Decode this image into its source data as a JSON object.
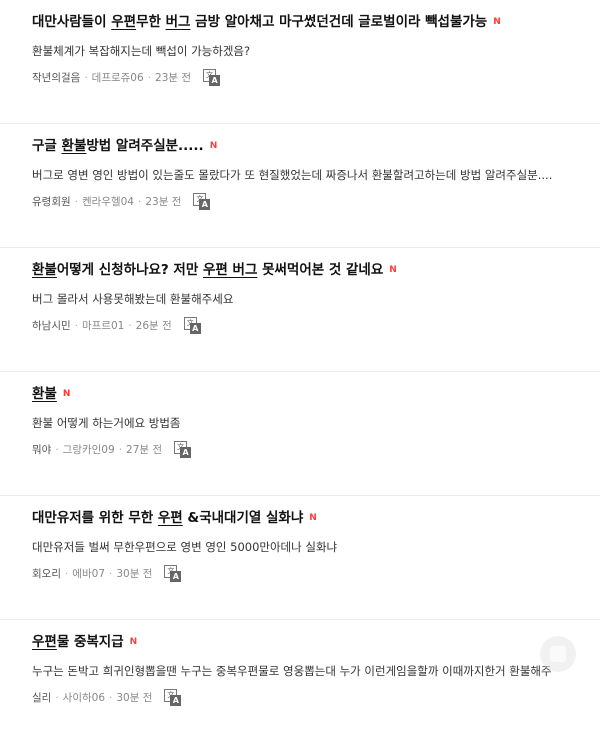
{
  "posts": [
    {
      "title_pre": "대만사람들이 ",
      "title_hl1": "우편",
      "title_mid": "무한 ",
      "title_hl2": "버그",
      "title_post": " 금방 알아채고 마구썼던건데 글로벌이라 빽섭불가능",
      "badge": "N",
      "excerpt": "환불체계가 복잡해지는데 빽섭이 가능하겠음?",
      "author": "작년의걸음",
      "server": "데프로쥬06",
      "time": "23분 전"
    },
    {
      "title_pre": "구글 ",
      "title_hl1": "환불",
      "title_mid": "방법 알려주실분.....",
      "title_hl2": "",
      "title_post": "",
      "badge": "N",
      "excerpt": "버그로 영변 영인 방법이 있는줄도 몰랐다가 또 현질했었는데 짜증나서 환불할려고하는데 방법 알려주실분....",
      "author": "유령회원",
      "server": "켄라우헬04",
      "time": "23분 전"
    },
    {
      "title_pre": "",
      "title_hl1": "환불",
      "title_mid": "어떻게 신청하나요? 저만 ",
      "title_hl2": "우편 버그",
      "title_post": " 못써먹어본 것 같네요",
      "badge": "N",
      "excerpt": "버그 몰라서 사용못해봤는데 환불해주세요",
      "author": "하남시민",
      "server": "마프르01",
      "time": "26분 전"
    },
    {
      "title_pre": "",
      "title_hl1": "환불",
      "title_mid": "",
      "title_hl2": "",
      "title_post": "",
      "badge": "N",
      "excerpt": "환불 어떻게 하는거에요 방법좀",
      "author": "뭐야",
      "server": "그랑카인09",
      "time": "27분 전"
    },
    {
      "title_pre": "대만유저를 위한 무한 ",
      "title_hl1": "우편",
      "title_mid": " &국내대기열 실화냐",
      "title_hl2": "",
      "title_post": "",
      "badge": "N",
      "excerpt": "대만유저들 벌써 무한우편으로 영변 영인 5000만아데나 실화냐",
      "author": "회오리",
      "server": "에바07",
      "time": "30분 전"
    },
    {
      "title_pre": "",
      "title_hl1": "우편",
      "title_mid": "물 중복지급",
      "title_hl2": "",
      "title_post": "",
      "badge": "N",
      "excerpt": "누구는 돈박고 희귀인형뽑을땐 누구는 중복우편물로 영웅뽑는대 누가 이런게임을할까 이때까지한거 환불해주",
      "author": "실리",
      "server": "사이하06",
      "time": "30분 전"
    }
  ],
  "meta_separator": "·",
  "translate_icon": {
    "name": "translate-icon",
    "back_glyph": "文",
    "front_glyph": "A"
  },
  "colors": {
    "badge": "#ff3b3b",
    "title": "#111111",
    "excerpt": "#333333",
    "meta": "#888888",
    "divider": "#ebebeb"
  }
}
